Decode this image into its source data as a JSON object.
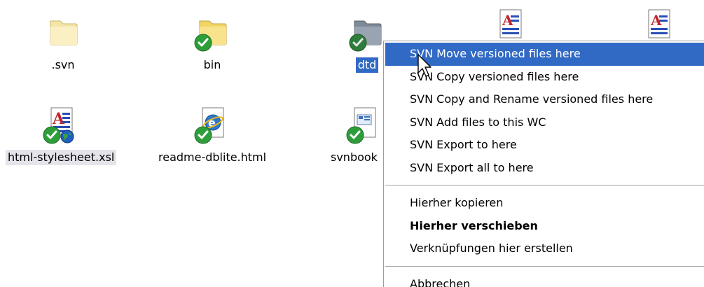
{
  "files": [
    {
      "name": ".svn",
      "icon": "folder-icon",
      "badge": "none"
    },
    {
      "name": "bin",
      "icon": "folder-icon",
      "badge": "svn-normal-badge"
    },
    {
      "name": "dtd",
      "icon": "folder-icon",
      "badge": "svn-normal-badge",
      "state": "selected"
    },
    {
      "name": "html-stylesheet.xsl",
      "icon": "xsl-document-icon",
      "badge": "svn-normal-badge"
    },
    {
      "name": "readme-dblite.html",
      "icon": "html-document-icon",
      "badge": "svn-normal-badge"
    },
    {
      "name": "svnbook",
      "icon": "document-icon",
      "badge": "svn-normal-badge"
    }
  ],
  "context_menu": {
    "svn_items": [
      "SVN Move versioned files here",
      "SVN Copy versioned files here",
      "SVN Copy and Rename versioned files here",
      "SVN Add files to this WC",
      "SVN Export to here",
      "SVN Export all to here"
    ],
    "explorer_items": [
      "Hierher kopieren",
      "Hierher verschieben",
      "Verknüpfungen hier erstellen"
    ],
    "cancel_item": "Abbrechen",
    "highlighted_index": 0,
    "default_item": "Hierher verschieben"
  },
  "colors": {
    "selection": "#316ac5",
    "badge_green": "#2e9e3a",
    "folder_yellow": "#f7df7a",
    "folder_gray": "#8e9aa6"
  }
}
